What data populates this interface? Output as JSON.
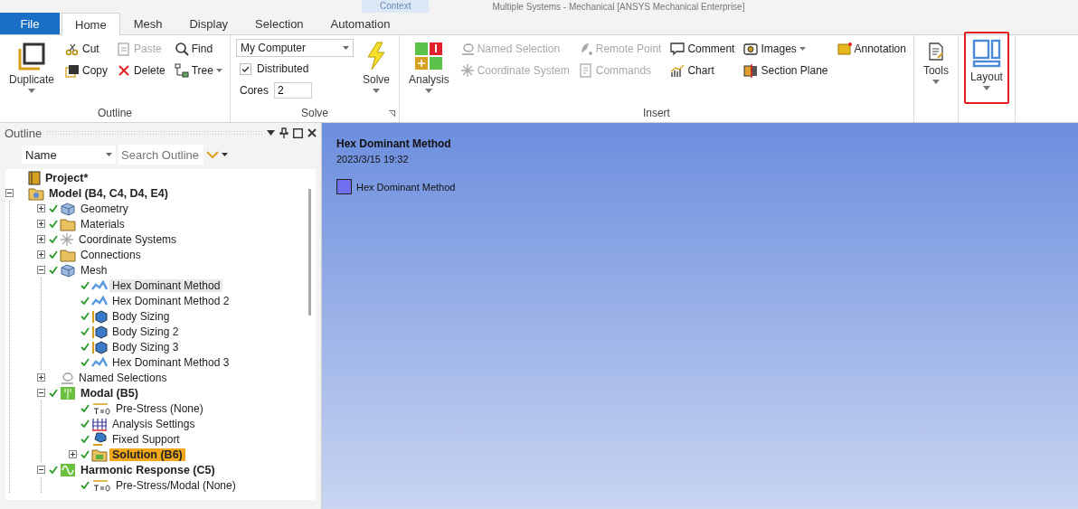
{
  "window": {
    "title": "Multiple Systems - Mechanical [ANSYS Mechanical Enterprise]",
    "context_tab": "Context"
  },
  "tabs": [
    {
      "label": "File",
      "kind": "file",
      "selected": false
    },
    {
      "label": "Home",
      "kind": "tab",
      "selected": true
    },
    {
      "label": "Mesh",
      "kind": "tab",
      "selected": false
    },
    {
      "label": "Display",
      "kind": "tab",
      "selected": false
    },
    {
      "label": "Selection",
      "kind": "tab",
      "selected": false
    },
    {
      "label": "Automation",
      "kind": "tab",
      "selected": false
    }
  ],
  "ribbon": {
    "groups": [
      {
        "label": "Outline",
        "columns": [
          [
            {
              "kind": "large",
              "label": "Duplicate",
              "disabled": false,
              "dropdown": true
            }
          ],
          [
            {
              "kind": "small",
              "label": "Cut",
              "disabled": false,
              "dropdown": false
            },
            {
              "kind": "small",
              "label": "Copy",
              "disabled": false,
              "dropdown": false
            }
          ],
          [
            {
              "kind": "small",
              "label": "Paste",
              "disabled": true,
              "dropdown": false
            },
            {
              "kind": "small",
              "label": "Delete",
              "disabled": false,
              "dropdown": false
            }
          ],
          [
            {
              "kind": "small",
              "label": "Find",
              "disabled": false,
              "dropdown": false
            },
            {
              "kind": "small",
              "label": "Tree",
              "disabled": false,
              "dropdown": true
            }
          ]
        ]
      },
      {
        "label": "Solve",
        "columns": [
          [
            {
              "kind": "select",
              "value": "My Computer"
            },
            {
              "kind": "checkbox",
              "label": "Distributed",
              "checked": true
            },
            {
              "kind": "number",
              "label": "Cores",
              "value": "2"
            }
          ],
          [
            {
              "kind": "large",
              "label": "Solve",
              "disabled": false,
              "dropdown": true
            }
          ]
        ]
      },
      {
        "label": "Insert",
        "columns": [
          [
            {
              "kind": "large",
              "label": "Analysis",
              "disabled": false,
              "dropdown": true
            }
          ],
          [
            {
              "kind": "small",
              "label": "Named Selection",
              "disabled": true,
              "dropdown": false
            },
            {
              "kind": "small",
              "label": "Coordinate System",
              "disabled": true,
              "dropdown": false
            }
          ],
          [
            {
              "kind": "small",
              "label": "Remote Point",
              "disabled": true,
              "dropdown": false
            },
            {
              "kind": "small",
              "label": "Commands",
              "disabled": true,
              "dropdown": false
            }
          ],
          [
            {
              "kind": "small",
              "label": "Comment",
              "disabled": false,
              "dropdown": false
            },
            {
              "kind": "small",
              "label": "Chart",
              "disabled": false,
              "dropdown": false
            }
          ],
          [
            {
              "kind": "small",
              "label": "Images",
              "disabled": false,
              "dropdown": true
            },
            {
              "kind": "small",
              "label": "Section Plane",
              "disabled": false,
              "dropdown": false
            }
          ],
          [
            {
              "kind": "small",
              "label": "Annotation",
              "disabled": false,
              "dropdown": false
            }
          ]
        ]
      },
      {
        "columns": [
          [
            {
              "kind": "large",
              "label": "Tools",
              "disabled": false,
              "dropdown": true,
              "highlighted": false
            }
          ]
        ]
      },
      {
        "columns": [
          [
            {
              "kind": "large",
              "label": "Layout",
              "disabled": false,
              "dropdown": true,
              "highlighted": true
            }
          ]
        ]
      }
    ]
  },
  "outline": {
    "title": "Outline",
    "filter_field": "Name",
    "search": {
      "placeholder": "Search Outline"
    },
    "tree": [
      {
        "label": "Project*",
        "kind": "project",
        "bold": true,
        "checked": false,
        "selected": false,
        "highlighted": false,
        "children": [
          {
            "label": "Model (B4, C4, D4, E4)",
            "kind": "model",
            "bold": true,
            "checked": false,
            "selected": false,
            "highlighted": false,
            "expanded": true,
            "children": [
              {
                "label": "Geometry",
                "kind": "geometry",
                "bold": false,
                "checked": true,
                "selected": false,
                "highlighted": false,
                "expanded": false
              },
              {
                "label": "Materials",
                "kind": "folder",
                "bold": false,
                "checked": true,
                "selected": false,
                "highlighted": false,
                "expanded": false
              },
              {
                "label": "Coordinate Systems",
                "kind": "coordinates",
                "bold": false,
                "checked": true,
                "selected": false,
                "highlighted": false,
                "expanded": false
              },
              {
                "label": "Connections",
                "kind": "folder",
                "bold": false,
                "checked": true,
                "selected": false,
                "highlighted": false,
                "expanded": false
              },
              {
                "label": "Mesh",
                "kind": "geometry",
                "bold": false,
                "checked": true,
                "selected": false,
                "highlighted": false,
                "expanded": true,
                "children": [
                  {
                    "label": "Hex Dominant Method",
                    "kind": "method",
                    "bold": false,
                    "checked": true,
                    "selected": true,
                    "highlighted": false
                  },
                  {
                    "label": "Hex Dominant Method 2",
                    "kind": "method",
                    "bold": false,
                    "checked": true,
                    "selected": false,
                    "highlighted": false
                  },
                  {
                    "label": "Body Sizing",
                    "kind": "sizing",
                    "bold": false,
                    "checked": true,
                    "selected": false,
                    "highlighted": false
                  },
                  {
                    "label": "Body Sizing 2",
                    "kind": "sizing",
                    "bold": false,
                    "checked": true,
                    "selected": false,
                    "highlighted": false
                  },
                  {
                    "label": "Body Sizing 3",
                    "kind": "sizing",
                    "bold": false,
                    "checked": true,
                    "selected": false,
                    "highlighted": false
                  },
                  {
                    "label": "Hex Dominant Method 3",
                    "kind": "method",
                    "bold": false,
                    "checked": true,
                    "selected": false,
                    "highlighted": false
                  }
                ]
              },
              {
                "label": "Named Selections",
                "kind": "selections",
                "bold": false,
                "checked": false,
                "selected": false,
                "highlighted": false,
                "expanded": false
              },
              {
                "label": "Modal (B5)",
                "kind": "modal",
                "bold": true,
                "checked": true,
                "selected": false,
                "highlighted": false,
                "expanded": true,
                "children": [
                  {
                    "label": "Pre-Stress (None)",
                    "kind": "prestress",
                    "bold": false,
                    "checked": true,
                    "selected": false,
                    "highlighted": false
                  },
                  {
                    "label": "Analysis Settings",
                    "kind": "settings",
                    "bold": false,
                    "checked": true,
                    "selected": false,
                    "highlighted": false
                  },
                  {
                    "label": "Fixed Support",
                    "kind": "support",
                    "bold": false,
                    "checked": true,
                    "selected": false,
                    "highlighted": false
                  },
                  {
                    "label": "Solution (B6)",
                    "kind": "solution",
                    "bold": true,
                    "checked": true,
                    "selected": false,
                    "highlighted": true,
                    "expanded": false
                  }
                ]
              },
              {
                "label": "Harmonic Response (C5)",
                "kind": "harmonic",
                "bold": true,
                "checked": true,
                "selected": false,
                "highlighted": false,
                "expanded": true,
                "children": [
                  {
                    "label": "Pre-Stress/Modal (None)",
                    "kind": "prestress",
                    "bold": false,
                    "checked": true,
                    "selected": false,
                    "highlighted": false
                  }
                ]
              }
            ]
          }
        ]
      }
    ]
  },
  "graphics": {
    "title": "Hex Dominant Method",
    "timestamp": "2023/3/15 19:32",
    "legend": [
      {
        "label": "Hex Dominant Method",
        "color": "#6f6ff0"
      }
    ]
  }
}
